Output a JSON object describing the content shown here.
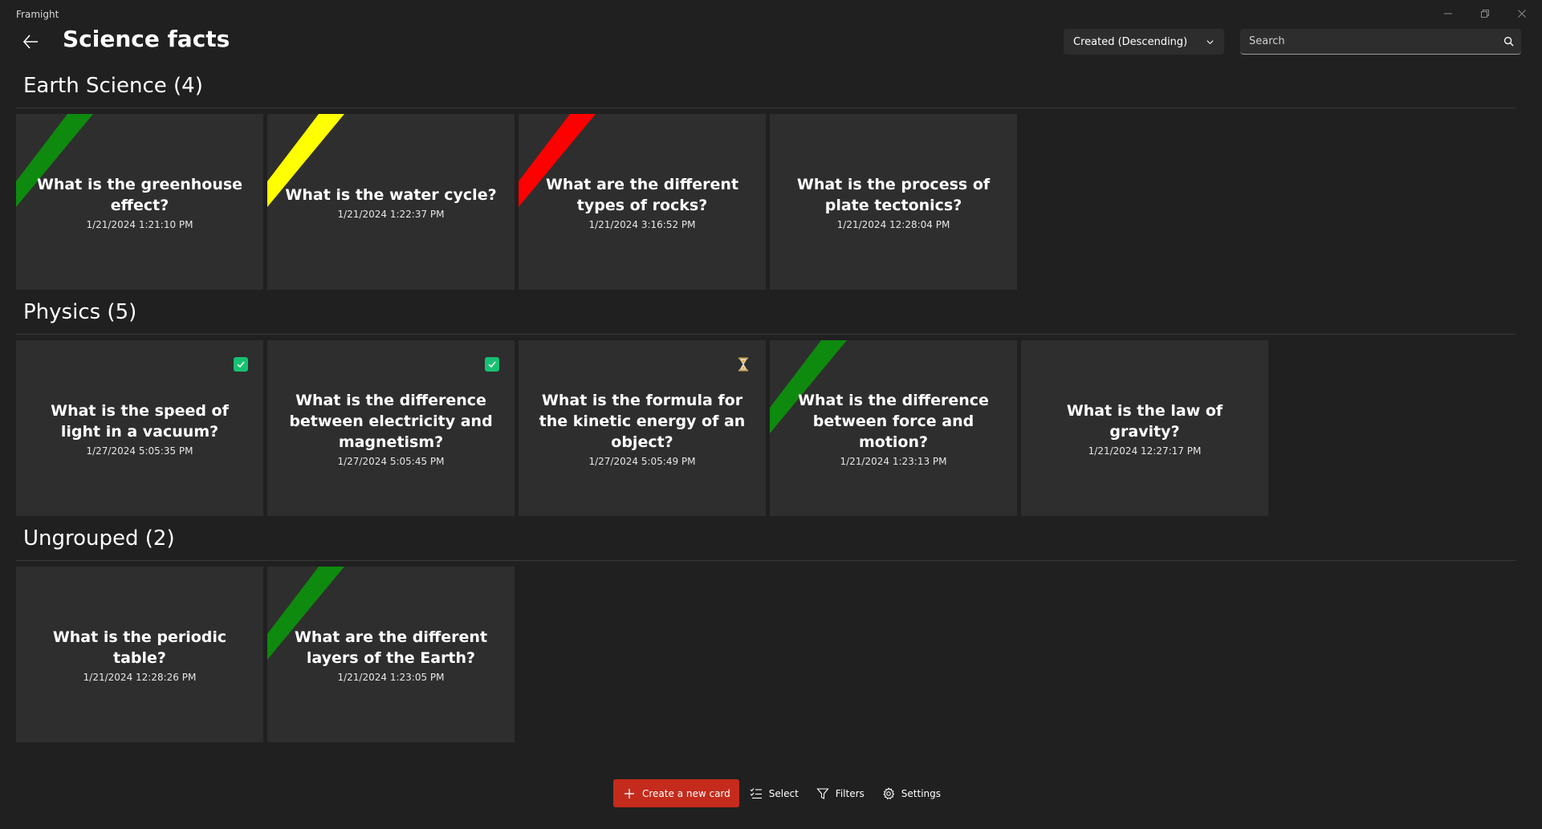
{
  "app": {
    "name": "Framight"
  },
  "header": {
    "title": "Science facts",
    "sort_selected": "Created (Descending)",
    "search_placeholder": "Search"
  },
  "colors": {
    "green": "#0e8a0e",
    "yellow": "#ffff00",
    "red": "#ff0000",
    "check": "#16c172",
    "accent": "#c42b1c"
  },
  "groups": [
    {
      "header": "Earth Science (4)",
      "cards": [
        {
          "question": "What is the greenhouse effect?",
          "date": "1/21/2024 1:21:10 PM",
          "ribbon": "green",
          "status": ""
        },
        {
          "question": "What is the water cycle?",
          "date": "1/21/2024 1:22:37 PM",
          "ribbon": "yellow",
          "status": ""
        },
        {
          "question": "What are the different types of rocks?",
          "date": "1/21/2024 3:16:52 PM",
          "ribbon": "red",
          "status": ""
        },
        {
          "question": "What is the process of plate tectonics?",
          "date": "1/21/2024 12:28:04 PM",
          "ribbon": "",
          "status": ""
        }
      ]
    },
    {
      "header": "Physics (5)",
      "cards": [
        {
          "question": "What is the speed of light in a vacuum?",
          "date": "1/27/2024 5:05:35 PM",
          "ribbon": "",
          "status": "check"
        },
        {
          "question": "What is the difference between electricity and magnetism?",
          "date": "1/27/2024 5:05:45 PM",
          "ribbon": "",
          "status": "check"
        },
        {
          "question": "What is the formula for the kinetic energy of an object?",
          "date": "1/27/2024 5:05:49 PM",
          "ribbon": "",
          "status": "hourglass"
        },
        {
          "question": "What is the difference between force and motion?",
          "date": "1/21/2024 1:23:13 PM",
          "ribbon": "green",
          "status": ""
        },
        {
          "question": "What is the law of gravity?",
          "date": "1/21/2024 12:27:17 PM",
          "ribbon": "",
          "status": ""
        }
      ]
    },
    {
      "header": "Ungrouped (2)",
      "cards": [
        {
          "question": "What is the periodic table?",
          "date": "1/21/2024 12:28:26 PM",
          "ribbon": "",
          "status": ""
        },
        {
          "question": "What are the different layers of the Earth?",
          "date": "1/21/2024 1:23:05 PM",
          "ribbon": "green",
          "status": ""
        }
      ]
    }
  ],
  "command_bar": {
    "create_label": "Create a new card",
    "select_label": "Select",
    "filters_label": "Filters",
    "settings_label": "Settings"
  },
  "icons": {
    "back": "arrow-left-icon",
    "sort": "chevron-down-icon",
    "search": "search-icon",
    "create": "plus-icon",
    "select": "checklist-icon",
    "filters": "filter-icon",
    "settings": "gear-icon"
  }
}
